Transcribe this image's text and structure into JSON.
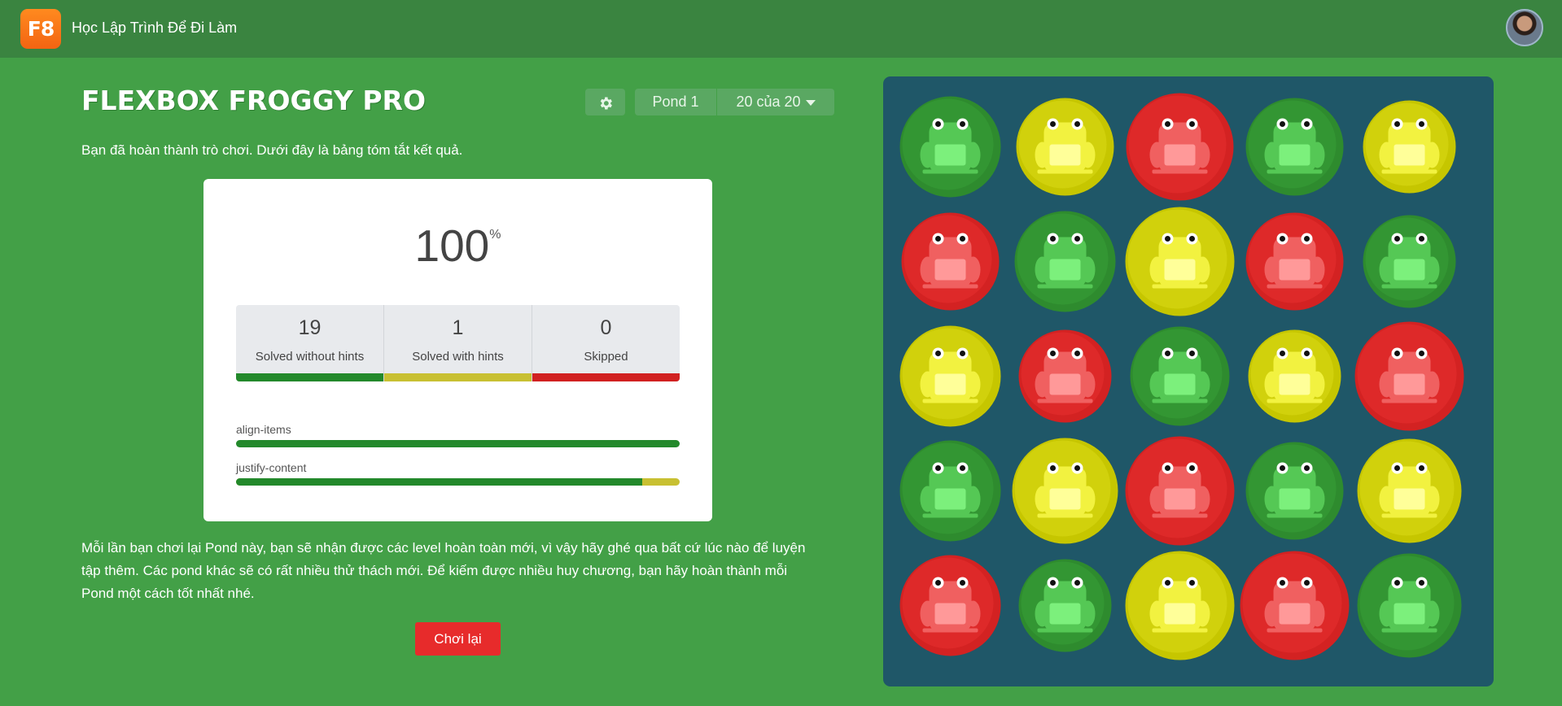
{
  "header": {
    "logo_text": "F8",
    "site_title": "Học Lập Trình Để Đi Làm",
    "avatar_icon": "user-avatar"
  },
  "game": {
    "title": "FLEXBOX FROGGY PRO",
    "settings_icon": "gear-icon",
    "pond_label": "Pond 1",
    "level_label": "20 của 20",
    "summary_intro": "Bạn đã hoàn thành trò chơi. Dưới đây là bảng tóm tắt kết quả.",
    "score_value": "100",
    "score_unit": "%",
    "stats": [
      {
        "value": "19",
        "label": "Solved without hints",
        "color": "#23892b"
      },
      {
        "value": "1",
        "label": "Solved with hints",
        "color": "#c8c032"
      },
      {
        "value": "0",
        "label": "Skipped",
        "color": "#d12121"
      }
    ],
    "skills": [
      {
        "name": "align-items",
        "green_fraction": 1.0
      },
      {
        "name": "justify-content",
        "green_fraction": 0.915
      }
    ],
    "footer_text": "Mỗi lần bạn chơi lại Pond này, bạn sẽ nhận được các level hoàn toàn mới, vì vậy hãy ghé qua bất cứ lúc nào để luyện tập thêm. Các pond khác sẽ có rất nhiều thử thách mới. Để kiếm được nhiều huy chương, bạn hãy hoàn thành mỗi Pond một cách tốt nhất nhé.",
    "replay_label": "Chơi lại"
  },
  "pond": {
    "background": "#1f5768",
    "frogs": [
      [
        "green",
        "yellow",
        "red",
        "green",
        "yellow"
      ],
      [
        "red",
        "green",
        "yellow",
        "red",
        "green"
      ],
      [
        "yellow",
        "red",
        "green",
        "yellow",
        "red"
      ],
      [
        "green",
        "yellow",
        "red",
        "green",
        "yellow"
      ],
      [
        "red",
        "green",
        "yellow",
        "red",
        "green"
      ]
    ]
  },
  "colors": {
    "green": "#2e8b2e",
    "yellow": "#c6c600",
    "red": "#d32222"
  }
}
